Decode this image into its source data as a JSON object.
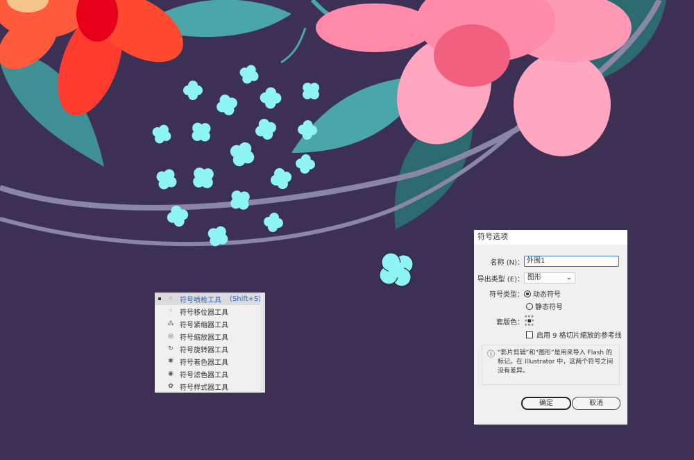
{
  "colors": {
    "background": "#3c3154",
    "accent_cyan": "#8ef4f4",
    "red_flower": "#ff3b2f",
    "pink_flower": "#ff8aaa",
    "leaf": "#4aa6a8",
    "arc": "#8a86a6"
  },
  "tool_menu": {
    "items": [
      {
        "label": "符号喷枪工具",
        "shortcut": "(Shift+S)",
        "icon": "symbol-sprayer-icon",
        "selected": true
      },
      {
        "label": "符号移位器工具",
        "icon": "symbol-shifter-icon"
      },
      {
        "label": "符号紧缩器工具",
        "icon": "symbol-scruncher-icon"
      },
      {
        "label": "符号缩放器工具",
        "icon": "symbol-sizer-icon"
      },
      {
        "label": "符号旋转器工具",
        "icon": "symbol-spinner-icon"
      },
      {
        "label": "符号着色器工具",
        "icon": "symbol-stainer-icon"
      },
      {
        "label": "符号滤色器工具",
        "icon": "symbol-screener-icon"
      },
      {
        "label": "符号样式器工具",
        "icon": "symbol-styler-icon"
      }
    ]
  },
  "dialog": {
    "title": "符号选项",
    "name_label": "名称 (N)：",
    "name_value": "外围1",
    "export_label": "导出类型 (E)：",
    "export_value": "图形",
    "symbol_type_label": "符号类型：",
    "dynamic": "动态符号",
    "static": "静态符号",
    "selected_type": "dynamic",
    "registration_label": "套版色：",
    "nine_slice_label": "启用 9 格切片缩放的参考线",
    "nine_slice_checked": false,
    "info_text": "“影片剪辑”和“图形”是用来导入 Flash 的标记。在 Illustrator 中，这两个符号之间没有差异。",
    "ok": "确定",
    "cancel": "取消"
  }
}
